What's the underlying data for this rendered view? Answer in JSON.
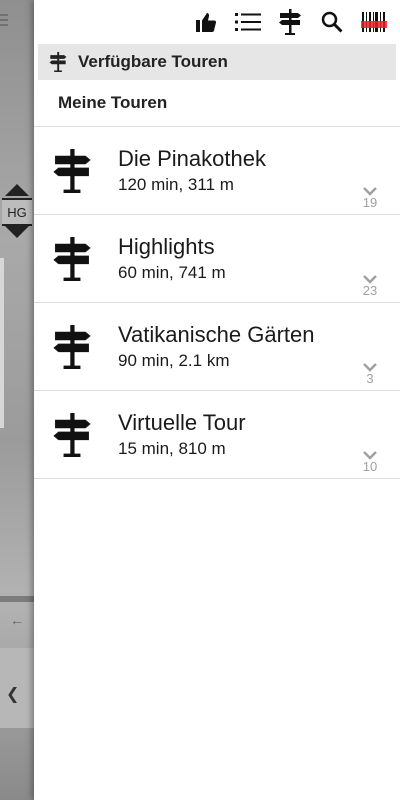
{
  "colors": {
    "drawer_bg": "#ffffff",
    "section_header_bg": "#e6e6e6",
    "text_primary": "#1a1a1a",
    "text_muted": "#a0a0a0",
    "barcode_accent": "#e8202a"
  },
  "toolbar": {
    "icons": [
      "thumbs-up-icon",
      "list-icon",
      "signpost-icon",
      "search-icon",
      "barcode-scanner-icon"
    ]
  },
  "background": {
    "hg_label": "HG"
  },
  "drawer": {
    "section_title": "Verfügbare Touren",
    "subheader": "Meine Touren",
    "tours": [
      {
        "name": "Die Pinakothek",
        "meta": "120 min, 311 m",
        "count": "19"
      },
      {
        "name": "Highlights",
        "meta": "60 min, 741 m",
        "count": "23"
      },
      {
        "name": "Vatikanische Gärten",
        "meta": "90 min, 2.1 km",
        "count": "3"
      },
      {
        "name": "Virtuelle Tour",
        "meta": "15 min, 810 m",
        "count": "10"
      }
    ]
  }
}
